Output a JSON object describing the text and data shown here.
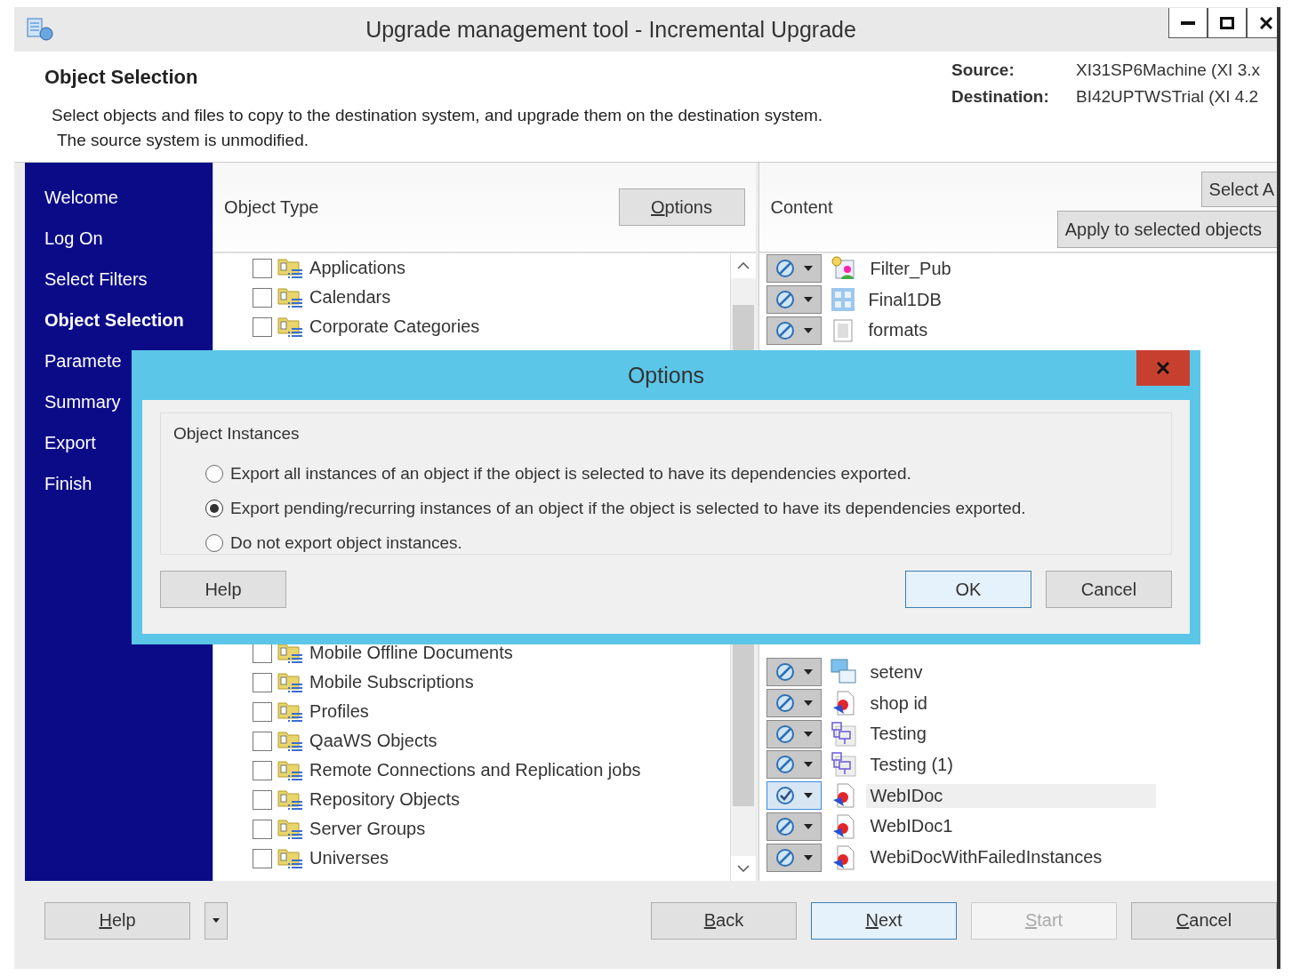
{
  "window": {
    "title": "Upgrade management tool - Incremental Upgrade"
  },
  "header": {
    "title": "Object Selection",
    "description": [
      "Select objects and files to copy to the destination system, and upgrade them on the destination system.",
      "The source system is unmodified."
    ],
    "systems": [
      {
        "label": "Source:",
        "value": "XI31SP6Machine (XI 3.x"
      },
      {
        "label": "Destination:",
        "value": "BI42UPTWSTrial (XI 4.2"
      }
    ]
  },
  "sidebar": {
    "items": [
      {
        "label": "Welcome",
        "selected": false
      },
      {
        "label": "Log On",
        "selected": false
      },
      {
        "label": "Select Filters",
        "selected": false
      },
      {
        "label": "Object Selection",
        "selected": true
      },
      {
        "label": "Paramete",
        "selected": false
      },
      {
        "label": "Summary",
        "selected": false
      },
      {
        "label": "Export",
        "selected": false
      },
      {
        "label": "Finish",
        "selected": false
      }
    ]
  },
  "object_type": {
    "title": "Object Type",
    "options_button": "Options",
    "items_top": [
      {
        "label": "Applications",
        "checked": false
      },
      {
        "label": "Calendars",
        "checked": false
      },
      {
        "label": "Corporate Categories",
        "checked": false
      }
    ],
    "items_bottom": [
      {
        "label": "Mobile Offline Documents",
        "checked": false
      },
      {
        "label": "Mobile Subscriptions",
        "checked": false
      },
      {
        "label": "Profiles",
        "checked": false
      },
      {
        "label": "QaaWS Objects",
        "checked": false
      },
      {
        "label": "Remote Connections and Replication jobs",
        "checked": false
      },
      {
        "label": "Repository Objects",
        "checked": false
      },
      {
        "label": "Server Groups",
        "checked": false
      },
      {
        "label": "Universes",
        "checked": false
      }
    ]
  },
  "content": {
    "title": "Content",
    "select_button": "Select A",
    "apply_dropdown": "Apply to selected objects",
    "items_top": [
      {
        "label": "Filter_Pub",
        "kind": "filter",
        "selected": false
      },
      {
        "label": "Final1DB",
        "kind": "grid",
        "selected": false
      },
      {
        "label": "formats",
        "kind": "text",
        "selected": false
      }
    ],
    "items_bottom": [
      {
        "label": "setenv",
        "kind": "program",
        "selected": false
      },
      {
        "label": "shop id",
        "kind": "webi",
        "selected": false
      },
      {
        "label": "Testing",
        "kind": "diagram",
        "selected": false
      },
      {
        "label": "Testing (1)",
        "kind": "diagram",
        "selected": false
      },
      {
        "label": "WebIDoc",
        "kind": "webi",
        "selected": true
      },
      {
        "label": "WebIDoc1",
        "kind": "webi",
        "selected": false
      },
      {
        "label": "WebiDocWithFailedInstances",
        "kind": "webi",
        "selected": false
      }
    ]
  },
  "footer": {
    "buttons": [
      {
        "label": "Help",
        "kind": "help",
        "disabled": false,
        "focused": false
      },
      {
        "label": "Back",
        "kind": "nav",
        "disabled": false,
        "focused": false
      },
      {
        "label": "Next",
        "kind": "nav",
        "disabled": false,
        "focused": true
      },
      {
        "label": "Start",
        "kind": "nav",
        "disabled": true,
        "focused": false
      },
      {
        "label": "Cancel",
        "kind": "nav",
        "disabled": false,
        "focused": false
      }
    ]
  },
  "dialog": {
    "title": "Options",
    "group_label": "Object Instances",
    "radios": [
      {
        "label": "Export all instances of an object if the object is selected to have its dependencies exported.",
        "selected": false
      },
      {
        "label": "Export pending/recurring instances of an object if the object is selected to have its dependencies exported.",
        "selected": true
      },
      {
        "label": "Do not export object instances.",
        "selected": false
      }
    ],
    "buttons": [
      {
        "label": "Help",
        "focused": false
      },
      {
        "label": "OK",
        "focused": true
      },
      {
        "label": "Cancel",
        "focused": false
      }
    ]
  }
}
